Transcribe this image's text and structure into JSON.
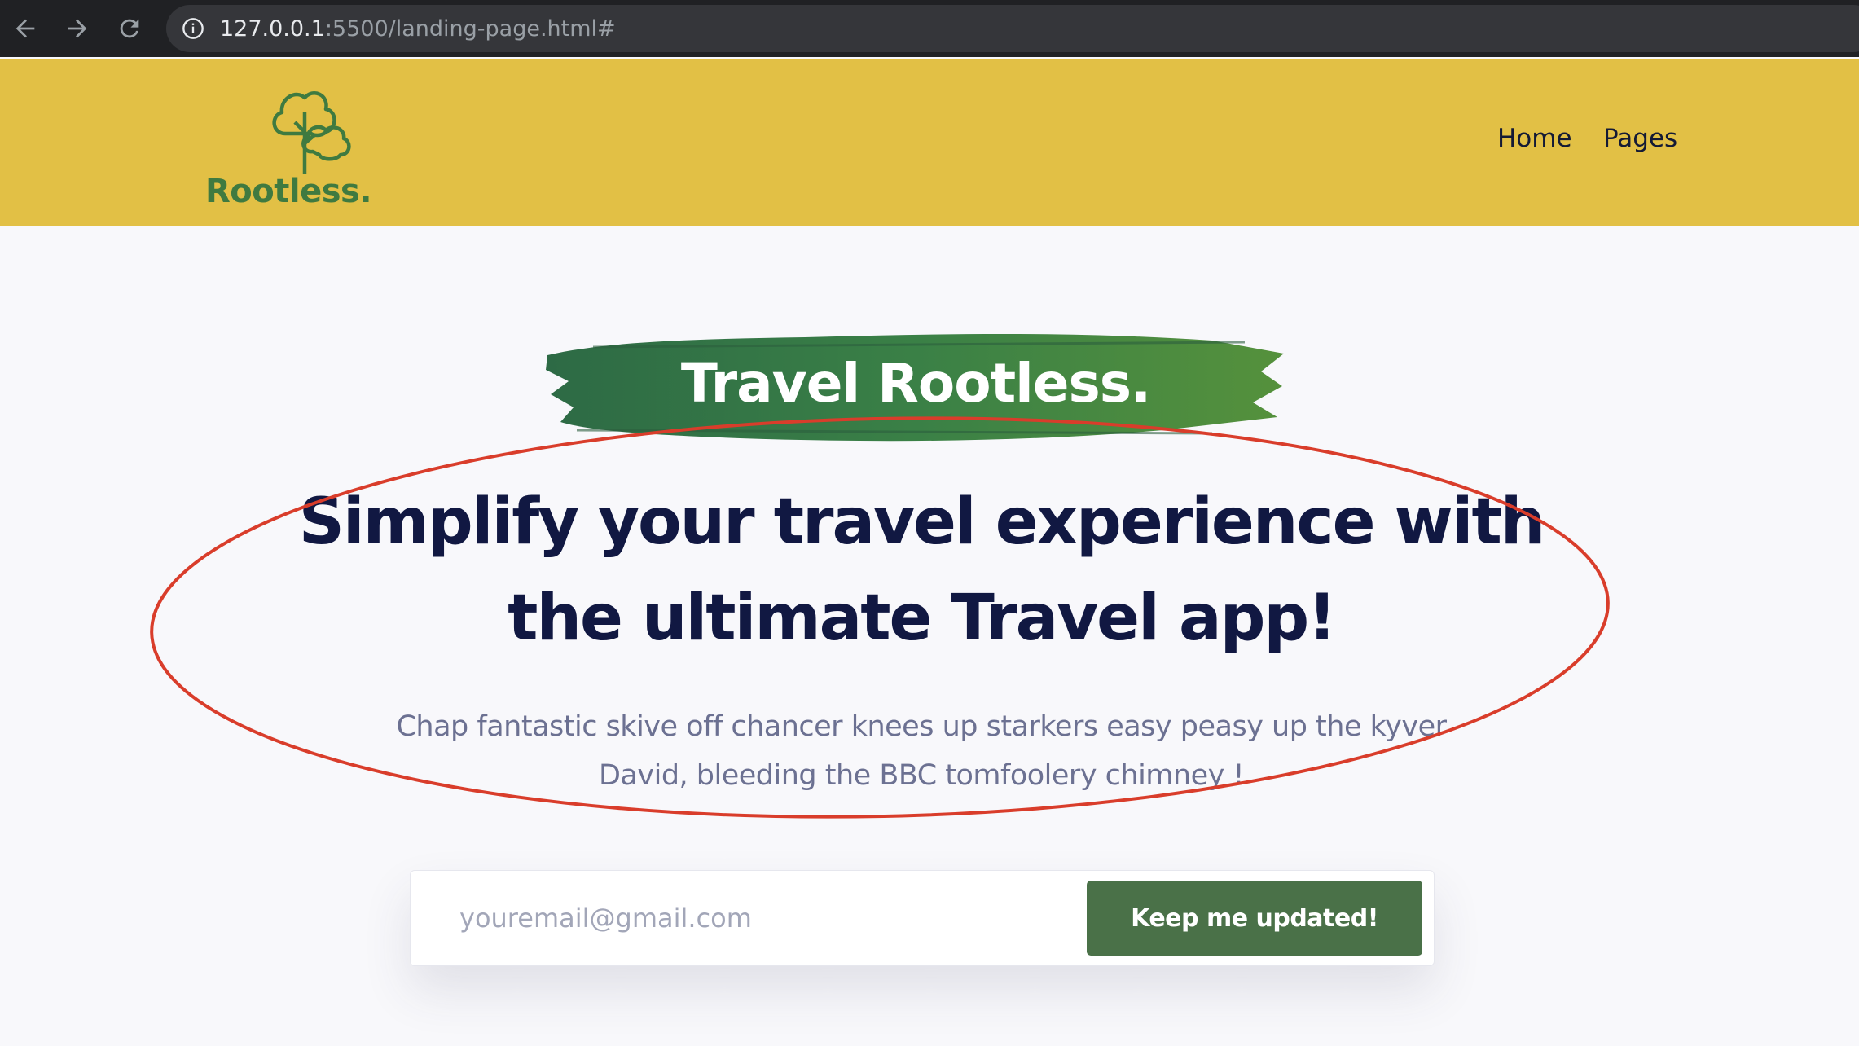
{
  "browser": {
    "url_host": "127.0.0.1",
    "url_rest": ":5500/landing-page.html#"
  },
  "header": {
    "logo_text": "Rootless.",
    "nav": [
      {
        "label": "Home"
      },
      {
        "label": "Pages"
      }
    ]
  },
  "hero": {
    "badge": "Travel Rootless.",
    "headline_line1_a": "Simplify your ",
    "headline_line1_b": "travel experience",
    "headline_line1_c": " with",
    "headline_line2_a": "the ultimate ",
    "headline_line2_b": "Travel",
    "headline_line2_c": " app!",
    "subtext": "Chap fantastic skive off chancer knees up starkers easy peasy up the kyver David, bleeding the BBC tomfoolery chimney !"
  },
  "signup": {
    "email_placeholder": "youremail@gmail.com",
    "button_label": "Keep me updated!"
  },
  "colors": {
    "header_bg": "#e2c045",
    "brand_green": "#3f7a40",
    "button_green": "#4a7148",
    "headline": "#111842",
    "annotation_red": "#d93d2b"
  }
}
